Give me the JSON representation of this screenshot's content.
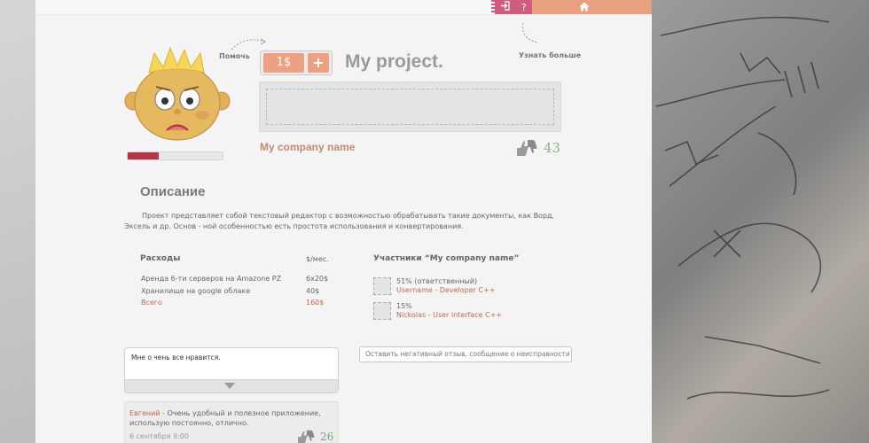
{
  "topbar": {
    "login_icon": "login-icon",
    "help_label": "?",
    "home_icon": "home-icon"
  },
  "avatar": {
    "icon": "sad-face-avatar",
    "mood_level": 0.33
  },
  "hints": {
    "help": "Помочь",
    "learn_more": "Узнать больше"
  },
  "project": {
    "donate_amount": "1$",
    "donate_plus": "+",
    "title": "My project.",
    "company": "My company name",
    "rating": "43"
  },
  "description": {
    "title": "Описание",
    "text": "Проект представляет собой текстовый редактор с возможностью обрабатывать такие документы, как Ворд, Эксель и др. Основ - ной особенностью есть простота использования и конвертирования."
  },
  "expenses": {
    "title": "Расходы",
    "unit": "$/мес.",
    "rows": [
      {
        "label": "Аренда 6-ти серверов на Amazone PZ",
        "value": "6x20$"
      },
      {
        "label": "Хранилище на google облаке",
        "value": "40$"
      }
    ],
    "total_label": "Всего",
    "total_value": "160$"
  },
  "participants": {
    "title": "Участники “My company name”",
    "members": [
      {
        "share": "51% (ответственный)",
        "name": "Username - Developer C++"
      },
      {
        "share": "15%",
        "name": "Nickolas - User interface C++"
      }
    ]
  },
  "comment": {
    "text": "Мне о чень все нравится.",
    "negative_placeholder": "Оставить негативный отзыв, сообщение о неисправности"
  },
  "review": {
    "author": "Евгений",
    "text": " - Очень удобный и полезное приложение, использую постоянно, отлично.",
    "date": "6 сентября 9:00",
    "rating": "26"
  },
  "colors": {
    "accent_orange": "#eba182",
    "accent_pink": "#d05d7c",
    "link": "#c06a4a",
    "rating_green": "#8ab18a",
    "mood_red": "#b33546"
  }
}
